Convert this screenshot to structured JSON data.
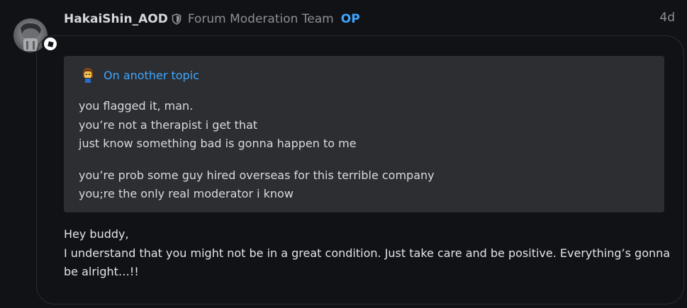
{
  "post": {
    "author": {
      "username": "HakaiShin_AOD",
      "group": "Forum Moderation Team",
      "op_label": "OP",
      "avatar_icon": "user-avatar",
      "badge_icon": "roblox-logo-icon",
      "shield_icon": "moderator-shield-icon"
    },
    "timestamp": "4d",
    "quote": {
      "title": "On another topic",
      "avatar_icon": "quoted-user-avatar",
      "lines_1": [
        "you flagged it, man.",
        "you’re not a therapist i get that",
        "just know something bad is gonna happen to me"
      ],
      "lines_2": [
        "you’re prob some guy hired overseas for this terrible company",
        "you;re the only real moderator i know"
      ]
    },
    "reply": {
      "greeting": "Hey buddy,",
      "body": "I understand that you might not be in a great condition. Just take care and be positive. Everything’s gonna be alright…!!"
    }
  },
  "colors": {
    "background": "#111216",
    "quote_background": "#2d2e32",
    "accent": "#3ea6ff",
    "muted": "#8d8f95"
  }
}
